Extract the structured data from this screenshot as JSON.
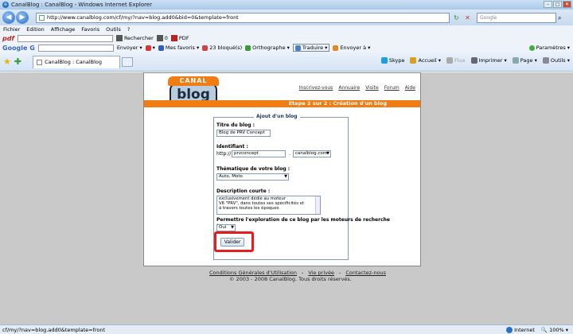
{
  "window": {
    "title": "CanalBlog : CanalBlog - Windows Internet Explorer"
  },
  "address": {
    "url": "http://www.canalblog.com/cf/my/?nav=blog.add0&bid=0&template=front",
    "search_placeholder": "Google"
  },
  "menu": [
    "Fichier",
    "Edition",
    "Affichage",
    "Favoris",
    "Outils",
    "?"
  ],
  "pdfbar": {
    "logo": "pdf",
    "rechercher": "Rechercher",
    "count": "0",
    "pdf": "PDF"
  },
  "googlebar": {
    "logo": "Google G",
    "envoyer": "Envoyer",
    "favoris": "Mes favoris",
    "bloques": "23 bloqué(s)",
    "orthographe": "Orthographe",
    "traduire": "Traduire",
    "envoyer_a": "Envoyer à",
    "parametres": "Paramètres"
  },
  "tabbar": {
    "tab_label": "CanalBlog : CanalBlog",
    "skype": "Skype",
    "accueil": "Accueil",
    "flux": "Flux",
    "imprimer": "Imprimer",
    "page": "Page",
    "outils": "Outils"
  },
  "page": {
    "logo_top": "CANAL",
    "logo_bottom": "blog",
    "links": [
      "Inscrivez-vous",
      "Annuaire",
      "Visite",
      "Forum",
      "Aide"
    ],
    "step": "Etape 2 sur 2 : Création d'un blog",
    "legend": "Ajout d'un blog",
    "titre_label": "Titre du blog :",
    "titre_value": "Blog de PRV Concept",
    "identifiant_label": "Identifiant :",
    "http_prefix": "http://",
    "identifiant_value": "prvconcept",
    "domain_sep": ".",
    "domain_value": "canalblog.com",
    "thematique_label": "Thématique de votre blog :",
    "thematique_value": "Auto, Moto",
    "description_label": "Description courte :",
    "description_lines": [
      "exclusivement dédié au moteur",
      "V6 \"PRV\", dans toutes ses spécificités et",
      "à travers toutes les époques"
    ],
    "exploration_label": "Permettre l'exploration de ce blog par les moteurs de recherche :",
    "exploration_value": "Oui",
    "validate": "Valider"
  },
  "footer": {
    "links": [
      "Conditions Générales d'Utilisation",
      "Vie privée",
      "Contactez-nous"
    ],
    "separators": [
      "-",
      "-"
    ],
    "copyright": "© 2003 - 2008 CanalBlog. Tous droits réservés."
  },
  "status": {
    "url": "cf/my/?nav=blog.add0&template=front",
    "zone": "Internet",
    "zoom": "100%"
  }
}
